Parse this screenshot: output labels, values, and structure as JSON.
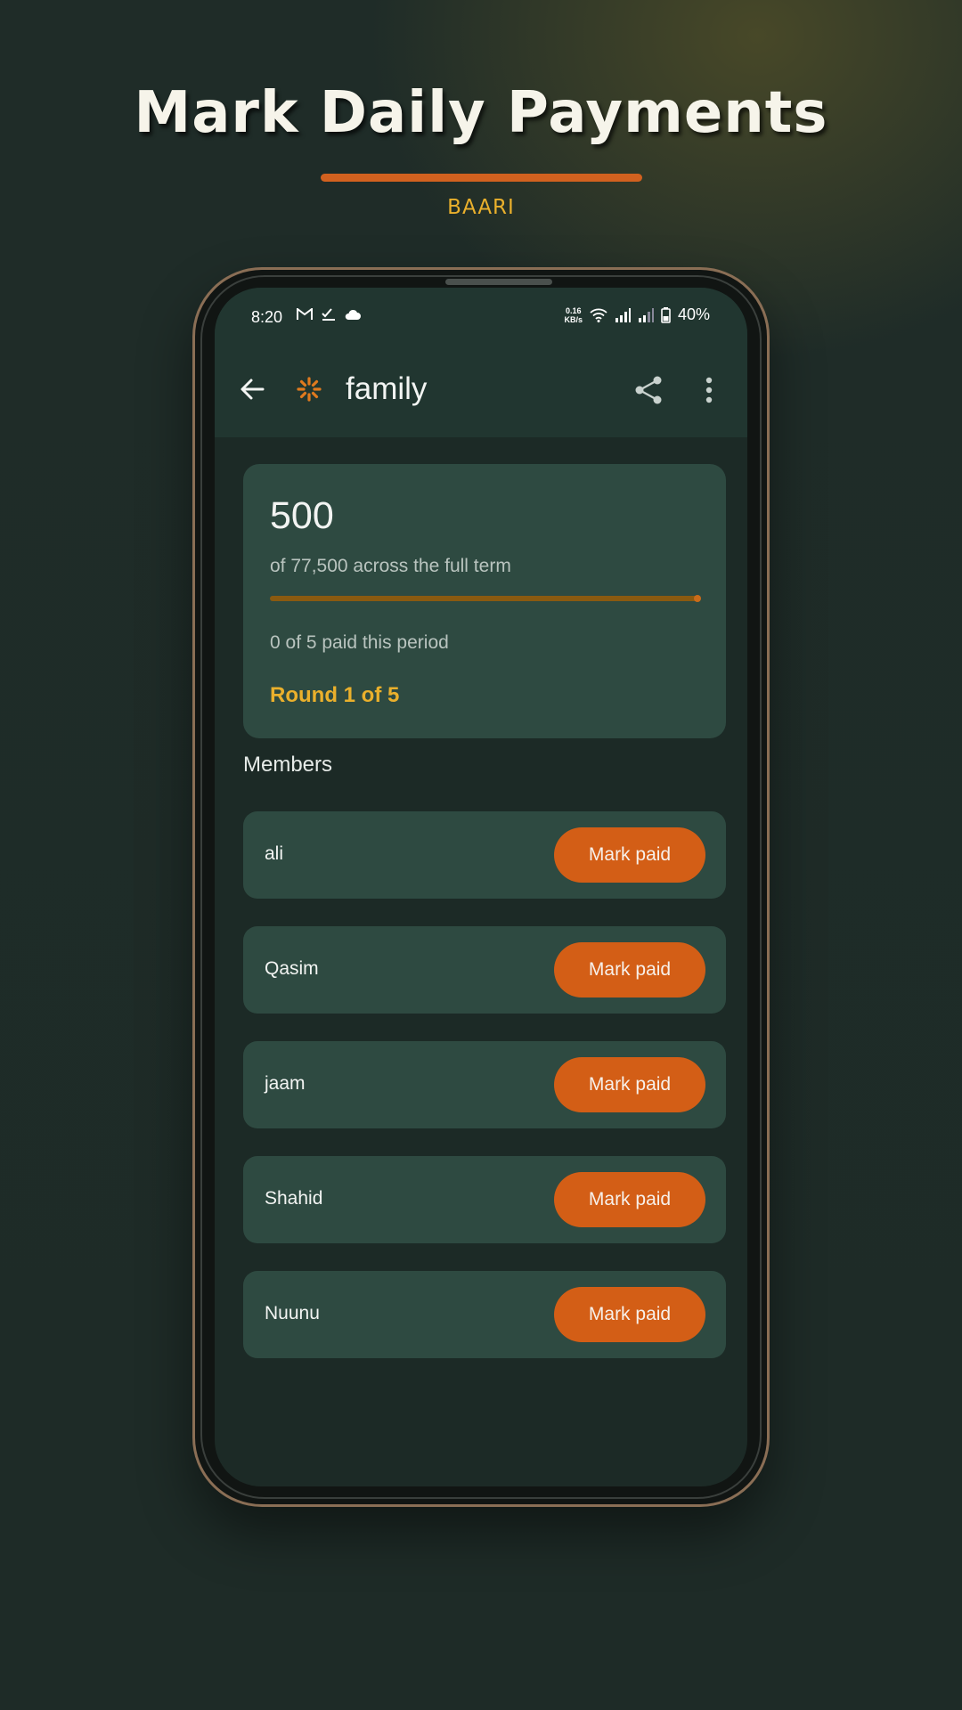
{
  "hero": {
    "title": "Mark Daily Payments",
    "brand": "BAARI"
  },
  "status_bar": {
    "time": "8:20",
    "net_speed_value": "0.16",
    "net_speed_unit": "KB/s",
    "battery": "40%",
    "left_icons": [
      "gmail-icon",
      "check-icon",
      "cloud-icon"
    ],
    "right_icons": [
      "wifi-icon",
      "signal-icon",
      "signal-icon",
      "battery-icon"
    ]
  },
  "app_bar": {
    "title": "family"
  },
  "summary": {
    "amount": "500",
    "total_text": "of 77,500 across the full term",
    "paid_text": "0 of 5 paid this period",
    "round_text": "Round 1 of 5",
    "progress_fraction": 0.0
  },
  "members": {
    "heading": "Members",
    "button_label": "Mark paid",
    "items": [
      {
        "name": "ali"
      },
      {
        "name": "Qasim"
      },
      {
        "name": "jaam"
      },
      {
        "name": "Shahid"
      },
      {
        "name": "Nuunu"
      }
    ]
  },
  "colors": {
    "accent_orange": "#d35e16",
    "accent_gold": "#eab02c",
    "card": "#2e4a41",
    "background": "#1e2b27"
  }
}
